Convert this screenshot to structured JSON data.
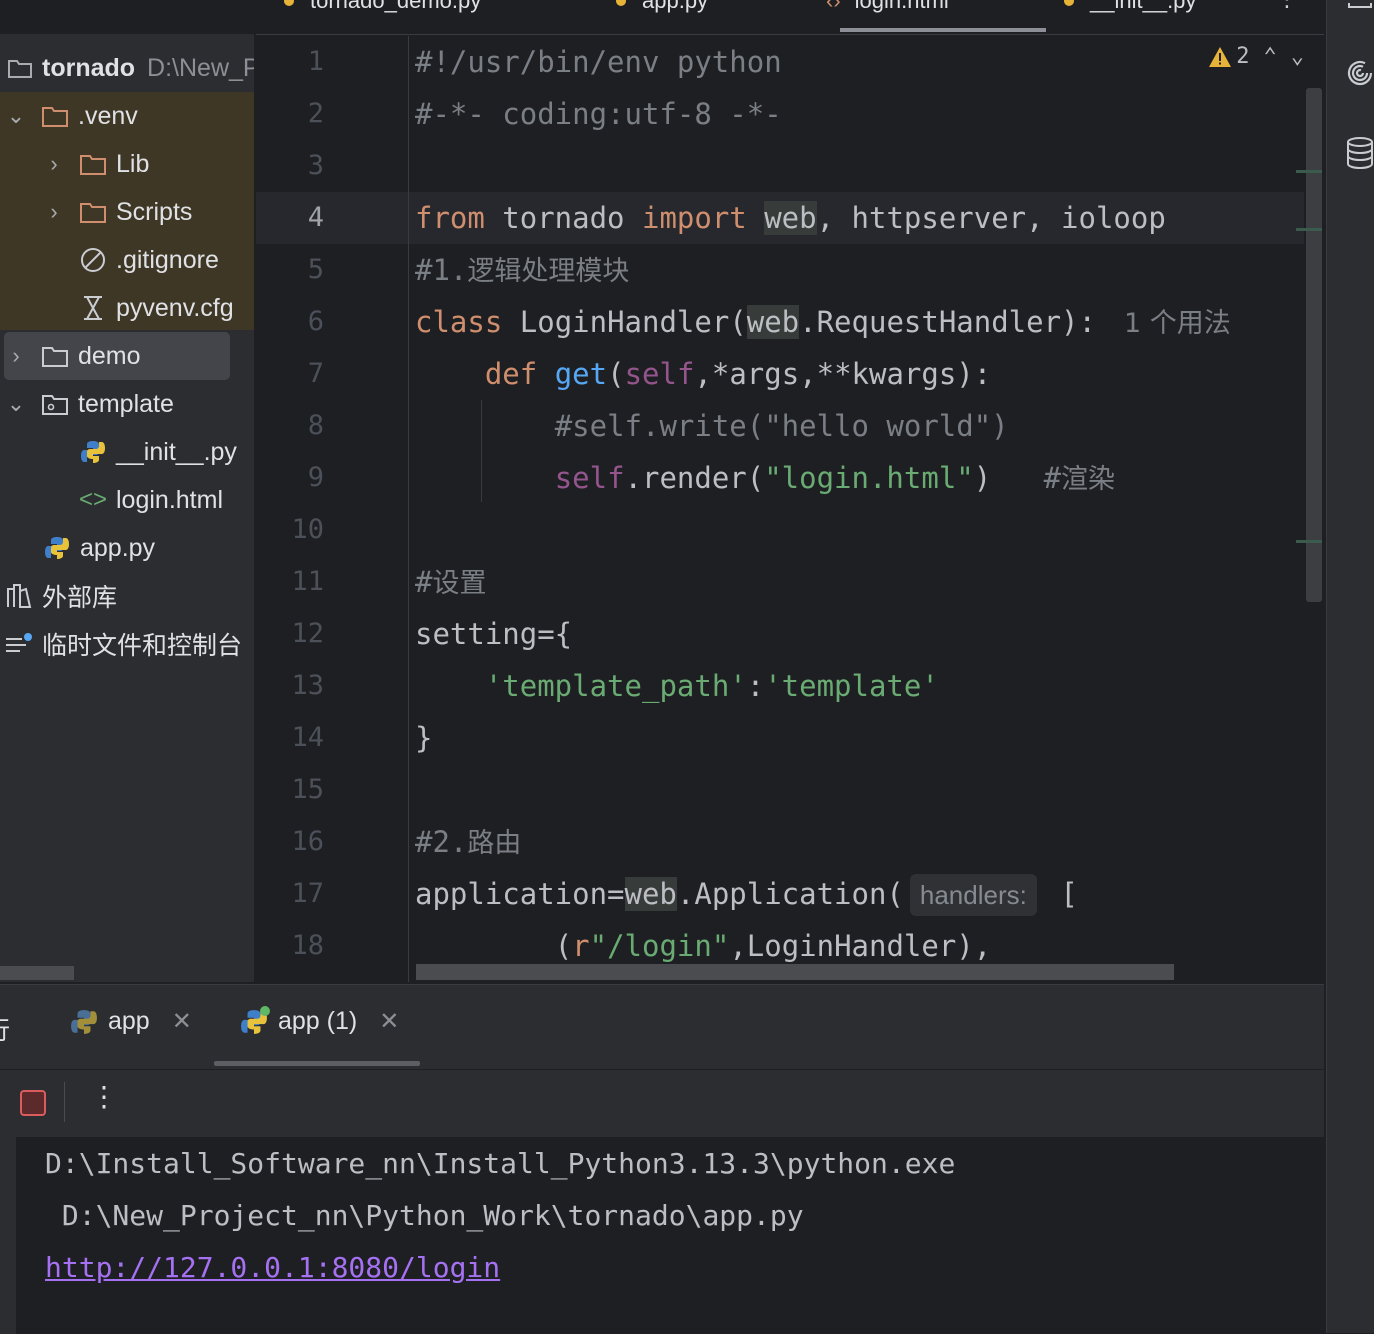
{
  "editor_tabs": [
    {
      "label": "tornado_demo.py"
    },
    {
      "label": "app.py",
      "active": true
    },
    {
      "label": "login.html"
    },
    {
      "label": "__init__.py"
    }
  ],
  "project": {
    "root_name": "tornado",
    "root_path": "D:\\New_Project_nn\\Python_Work\\tornado",
    "items": [
      {
        "label": ".venv",
        "type": "folder",
        "expanded": true
      },
      {
        "label": "Lib",
        "type": "folder"
      },
      {
        "label": "Scripts",
        "type": "folder"
      },
      {
        "label": ".gitignore",
        "type": "ignore-file"
      },
      {
        "label": "pyvenv.cfg",
        "type": "config-file"
      },
      {
        "label": "demo",
        "type": "folder",
        "selected": true
      },
      {
        "label": "template",
        "type": "folder",
        "expanded": true
      },
      {
        "label": "__init__.py",
        "type": "python-file"
      },
      {
        "label": "login.html",
        "type": "html-file"
      },
      {
        "label": "app.py",
        "type": "python-file"
      },
      {
        "label": "外部库",
        "type": "library"
      },
      {
        "label": "临时文件和控制台",
        "type": "scratches"
      }
    ]
  },
  "editor": {
    "warning_count": "2",
    "line_numbers": [
      "1",
      "2",
      "3",
      "4",
      "5",
      "6",
      "7",
      "8",
      "9",
      "10",
      "11",
      "12",
      "13",
      "14",
      "15",
      "16",
      "17",
      "18"
    ],
    "current_line": "4",
    "code": {
      "l1": "#!/usr/bin/env python",
      "l2": "#-*- coding:utf-8 -*-",
      "l4": {
        "from": "from",
        "tornado": " tornado ",
        "import": "import",
        "sp": " ",
        "web": "web",
        "rest": ", httpserver, ioloop"
      },
      "l5": {
        "prefix": "#1.",
        "cjk": "逻辑处理模块"
      },
      "l6": {
        "class": "class",
        "name": " LoginHandler(",
        "web": "web",
        "rest": ".RequestHandler):",
        "usage": "1 个用法"
      },
      "l7": {
        "indent": "    ",
        "def": "def",
        "sp": " ",
        "get": "get",
        "p1": "(",
        "self": "self",
        "args": ",*args,**kwargs):"
      },
      "l8": {
        "indent": "        ",
        "text": "#self.write(\"hello world\")"
      },
      "l9": {
        "indent": "        ",
        "self": "self",
        "call": ".render(",
        "str": "\"login.html\"",
        "close": ")",
        "comment_hash": "   #",
        "comment_cjk": "渲染"
      },
      "l11": {
        "prefix": "#",
        "cjk": "设置"
      },
      "l12": "setting={",
      "l13": {
        "indent": "    ",
        "key": "'template_path'",
        "colon": ":",
        "val": "'template'"
      },
      "l14": "}",
      "l16": {
        "prefix": "#2.",
        "cjk": "路由"
      },
      "l17": {
        "pre": "application=",
        "web": "web",
        "rest": ".Application(",
        "hint": "handlers:",
        "bracket": " ["
      },
      "l18": {
        "indent": "        ",
        "p": "(",
        "r": "r",
        "str": "\"/login\"",
        "rest": ",LoginHandler),"
      }
    }
  },
  "run_panel": {
    "title": "运行",
    "tabs": [
      {
        "label": "app"
      },
      {
        "label": "app (1)",
        "active": true
      }
    ],
    "console": {
      "line1": "D:\\Install_Software_nn\\Install_Python3.13.3\\python.exe",
      "line2": " D:\\New_Project_nn\\Python_Work\\tornado\\app.py",
      "link": "http://127.0.0.1:8080/login"
    }
  },
  "colors": {
    "keyword": "#cf8e6d",
    "comment": "#7a7e85",
    "string": "#6aab73",
    "function": "#56a8f5",
    "self": "#94558d",
    "link": "#a571f2",
    "venv_highlight": "#3f3726"
  }
}
